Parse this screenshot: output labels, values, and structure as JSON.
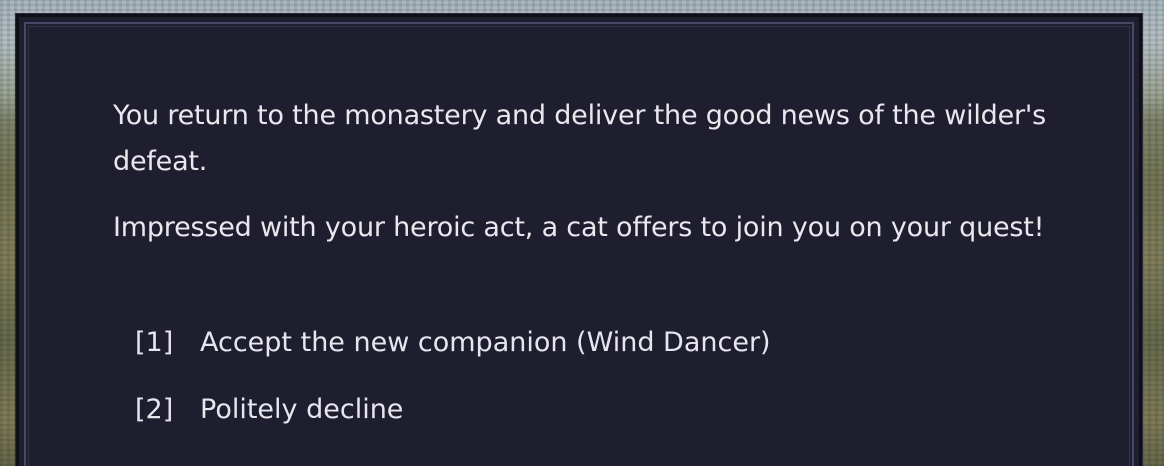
{
  "dialog": {
    "paragraphs": [
      "You return to the monastery and deliver the good news of the wilder's defeat.",
      "Impressed with your heroic act, a cat offers to join you on your quest!"
    ],
    "choices": [
      {
        "key": "[1]",
        "label": "Accept the new companion (Wind Dancer)"
      },
      {
        "key": "[2]",
        "label": "Politely decline"
      }
    ]
  },
  "colors": {
    "panel_background": "#1f1e2e",
    "panel_border": "#4a4766",
    "text": "#e8e8ee"
  }
}
